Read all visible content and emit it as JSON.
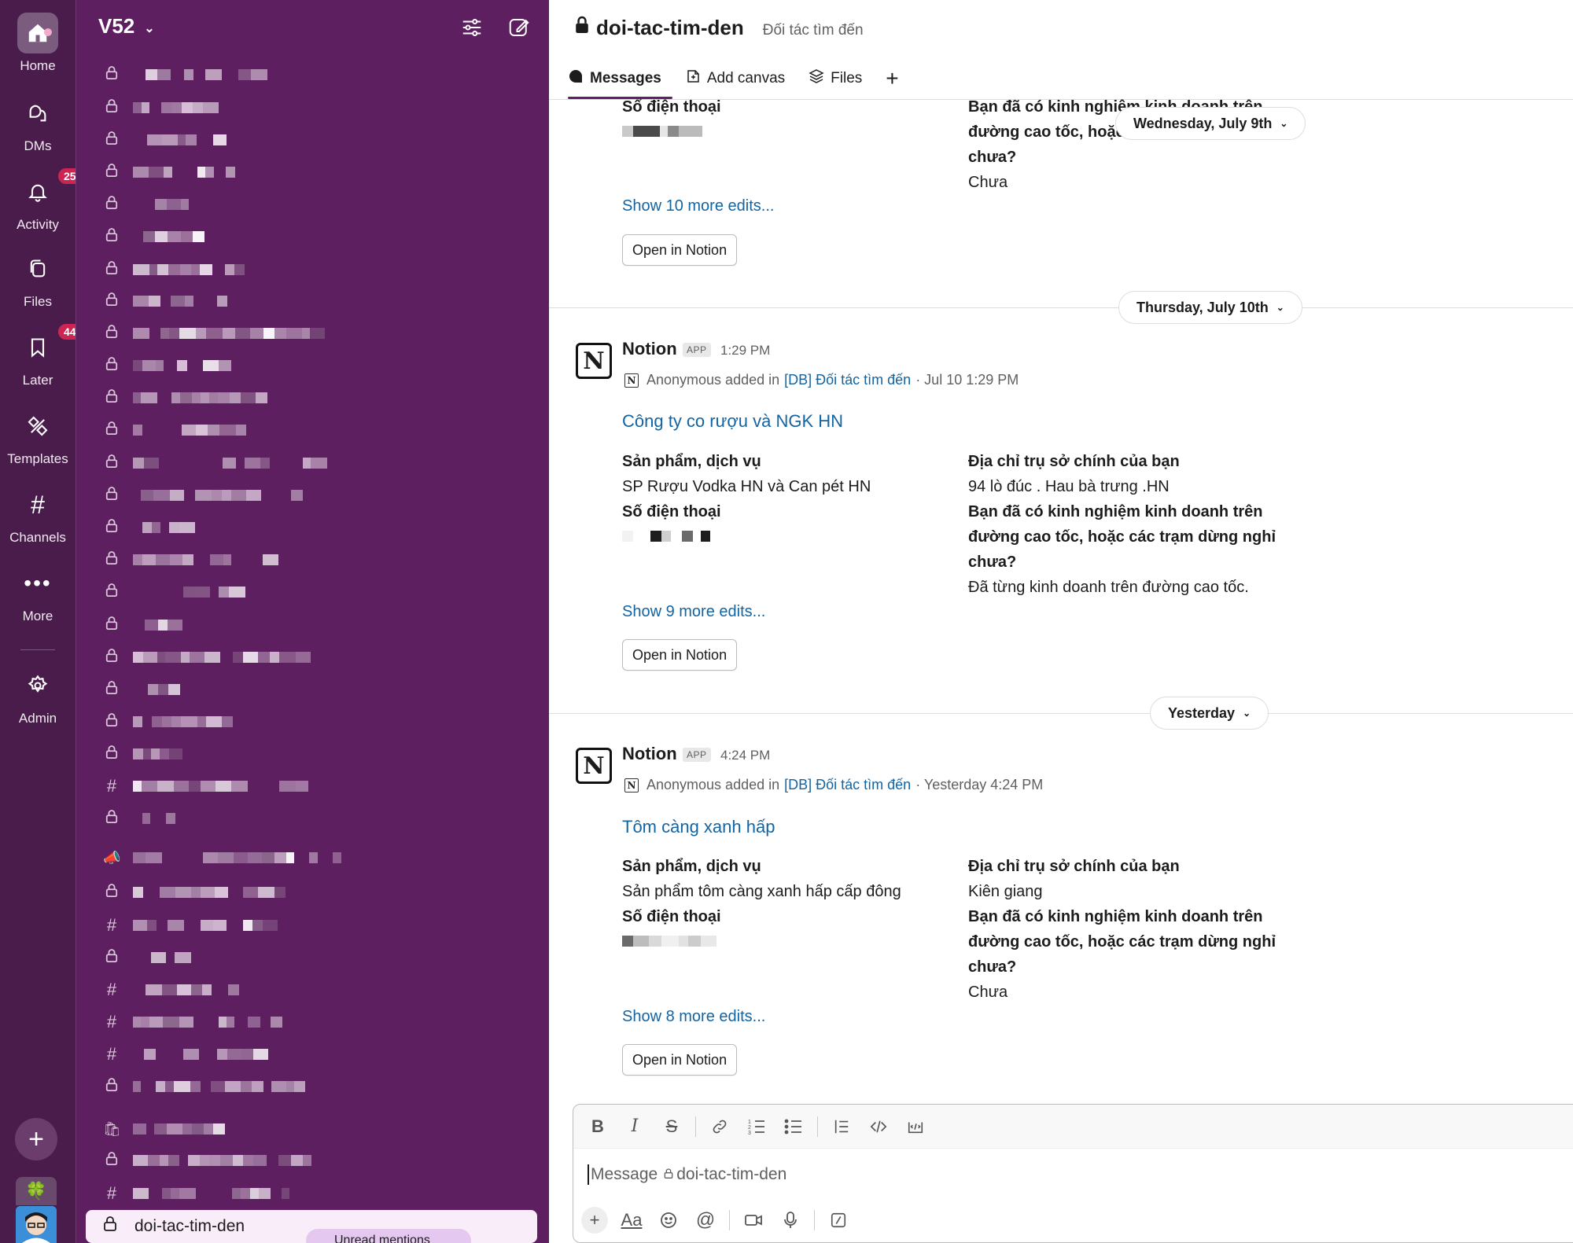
{
  "rail": {
    "items": [
      {
        "label": "Home",
        "icon": "home-icon"
      },
      {
        "label": "DMs",
        "icon": "dms-icon"
      },
      {
        "label": "Activity",
        "icon": "bell-icon",
        "badge": "25"
      },
      {
        "label": "Files",
        "icon": "files-icon"
      },
      {
        "label": "Later",
        "icon": "bookmark-icon",
        "badge": "44"
      },
      {
        "label": "Templates",
        "icon": "templates-icon"
      },
      {
        "label": "Channels",
        "icon": "hash-icon"
      },
      {
        "label": "More",
        "icon": "more-icon"
      },
      {
        "label": "Admin",
        "icon": "gear-icon"
      }
    ]
  },
  "sidebar": {
    "workspace": "V52",
    "active_channel": "doi-tac-tim-den",
    "unread_mentions": "Unread mentions"
  },
  "channel": {
    "name": "doi-tac-tim-den",
    "description": "Đối tác tìm đến"
  },
  "tabs": [
    {
      "label": "Messages",
      "icon": "messages-icon"
    },
    {
      "label": "Add canvas",
      "icon": "canvas-icon"
    },
    {
      "label": "Files",
      "icon": "files-icon"
    },
    {
      "label": "+",
      "icon": "plus-icon"
    }
  ],
  "messages": {
    "top": {
      "field_label_phone": "Số điện thoại",
      "right_question": "Bạn đã có kinh nghiệm kinh doanh trên đường cao tốc, hoặc các trạm dừng nghỉ chưa?",
      "right_q_line1": "Bạn đã có kinh nghiệm kinh doanh trên",
      "right_q_line2": "đường cao tốc, hoặc",
      "right_q_line3": "chưa?",
      "right_answer": "Chưa",
      "show_more": "Show 10 more edits...",
      "open_button": "Open in Notion",
      "day_pill": "Wednesday, July 9th"
    },
    "m1": {
      "day": "Thursday, July 10th",
      "sender": "Notion",
      "app_badge": "APP",
      "time": "1:29 PM",
      "meta_actor": "Anonymous added in",
      "meta_db": "[DB] Đối tác tìm đến",
      "meta_when": "· Jul 10 1:29 PM",
      "title": "Công ty co rượu và NGK HN",
      "label_product": "Sản phẩm, dịch vụ",
      "value_product": "SP Rượu Vodka HN và Can pét HN",
      "label_phone": "Số điện thoại",
      "label_address": "Địa chỉ trụ sở chính của bạn",
      "value_address": "94 lò đúc . Hau bà trưng .HN",
      "q_line1": "Bạn đã có kinh nghiệm kinh doanh trên",
      "q_line2": "đường cao tốc, hoặc các trạm dừng nghỉ",
      "q_line3": "chưa?",
      "answer": "Đã từng kinh doanh trên đường cao tốc.",
      "show_more": "Show 9 more edits...",
      "open_button": "Open in Notion"
    },
    "m2": {
      "day": "Yesterday",
      "sender": "Notion",
      "app_badge": "APP",
      "time": "4:24 PM",
      "meta_actor": "Anonymous added in",
      "meta_db": "[DB] Đối tác tìm đến",
      "meta_when": "· Yesterday 4:24 PM",
      "title": "Tôm càng xanh hấp",
      "label_product": "Sản phẩm, dịch vụ",
      "value_product": "Sản phẩm tôm càng xanh hấp cấp đông",
      "label_phone": "Số điện thoại",
      "label_address": "Địa chỉ trụ sở chính của bạn",
      "value_address": "Kiên giang",
      "q_line1": "Bạn đã có kinh nghiệm kinh doanh trên",
      "q_line2": "đường cao tốc, hoặc các trạm dừng nghỉ",
      "q_line3": "chưa?",
      "answer": "Chưa",
      "show_more": "Show 8 more edits...",
      "open_button": "Open in Notion"
    }
  },
  "composer": {
    "placeholder_prefix": "Message",
    "placeholder_channel": "doi-tac-tim-den",
    "format_buttons": [
      "bold-icon",
      "italic-icon",
      "strikethrough-icon",
      "link-icon",
      "ordered-list-icon",
      "bulleted-list-icon",
      "blockquote-icon",
      "code-icon",
      "code-block-icon"
    ],
    "bottom_buttons": [
      "plus-icon",
      "formatting-icon",
      "emoji-icon",
      "mention-icon",
      "video-icon",
      "microphone-icon",
      "slash-command-icon"
    ],
    "format_label": "Aa"
  },
  "colors": {
    "rail_bg": "#4a1c4c",
    "sidebar_bg": "#5d1f5f",
    "link": "#1264a3",
    "badge": "#cd2553"
  }
}
